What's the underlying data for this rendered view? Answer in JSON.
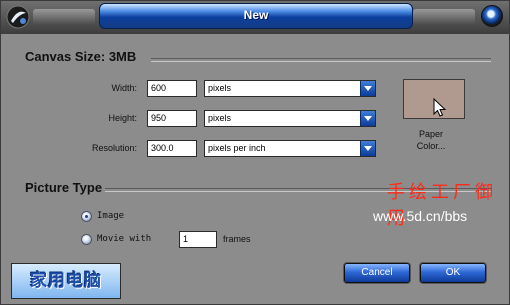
{
  "window": {
    "title": "New"
  },
  "canvas_size": {
    "heading": "Canvas Size: 3MB",
    "width": {
      "label": "Width:",
      "value": "600",
      "unit": "pixels"
    },
    "height": {
      "label": "Height:",
      "value": "950",
      "unit": "pixels"
    },
    "resolution": {
      "label": "Resolution:",
      "value": "300.0",
      "unit": "pixels per inch"
    },
    "paper_color": {
      "label_line1": "Paper",
      "label_line2": "Color...",
      "color": "#b09a90"
    }
  },
  "picture_type": {
    "heading": "Picture Type",
    "image_label": "Image",
    "movie_label": "Movie with",
    "frames_value": "1",
    "frames_label": "frames",
    "selected": "Image"
  },
  "buttons": {
    "cancel": "Cancel",
    "ok": "OK"
  },
  "overlay": {
    "cn_text": "手绘工厂御用",
    "url": "www.5d.cn/bbs",
    "logo_text": "家用电脑"
  },
  "colors": {
    "accent": "#0d3f9e",
    "dialog_bg": "#8c8c8c",
    "overlay_red": "#ff2a1a"
  }
}
